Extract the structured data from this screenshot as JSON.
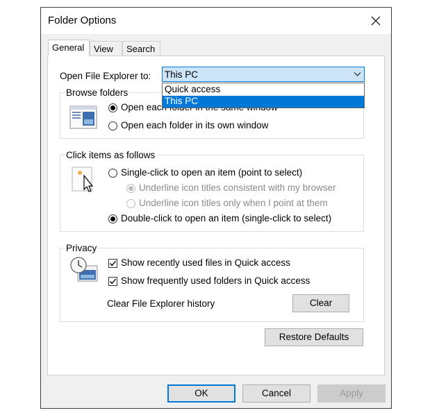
{
  "dialog": {
    "title": "Folder Options",
    "close_icon": "close-icon"
  },
  "tabs": [
    {
      "label": "General",
      "active": true
    },
    {
      "label": "View",
      "active": false
    },
    {
      "label": "Search",
      "active": false
    }
  ],
  "open_explorer": {
    "label": "Open File Explorer to:",
    "value": "This PC",
    "options": [
      {
        "label": "Quick access",
        "selected": false
      },
      {
        "label": "This PC",
        "selected": true
      }
    ]
  },
  "browse_folders": {
    "title": "Browse folders",
    "icon": "browse-folders-icon",
    "options": [
      {
        "label": "Open each folder in the same window",
        "checked": true
      },
      {
        "label": "Open each folder in its own window",
        "checked": false
      }
    ]
  },
  "click_items": {
    "title": "Click items as follows",
    "icon": "pointer-cursor-icon",
    "single_click": {
      "label": "Single-click to open an item (point to select)",
      "checked": false
    },
    "sub_options": [
      {
        "label": "Underline icon titles consistent with my browser",
        "checked": true,
        "enabled": false
      },
      {
        "label": "Underline icon titles only when I point at them",
        "checked": false,
        "enabled": false
      }
    ],
    "double_click": {
      "label": "Double-click to open an item (single-click to select)",
      "checked": true
    }
  },
  "privacy": {
    "title": "Privacy",
    "icon": "clock-history-icon",
    "checkboxes": [
      {
        "label": "Show recently used files in Quick access",
        "checked": true
      },
      {
        "label": "Show frequently used folders in Quick access",
        "checked": true
      }
    ],
    "clear_label": "Clear File Explorer history",
    "clear_button": "Clear"
  },
  "restore_defaults": "Restore Defaults",
  "footer": {
    "ok": "OK",
    "cancel": "Cancel",
    "apply": "Apply",
    "apply_enabled": false
  },
  "colors": {
    "accent": "#0078d7",
    "combo_bg": "#cce4f7",
    "dialog_bg": "#f0f0f0"
  }
}
